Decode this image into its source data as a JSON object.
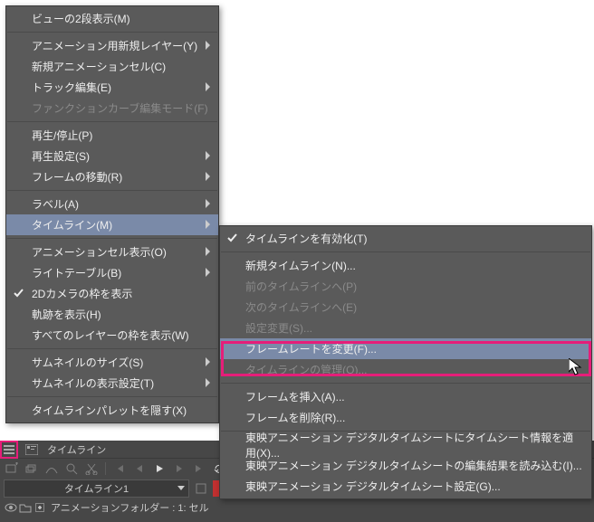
{
  "menu1": {
    "items": [
      {
        "label": "ビューの2段表示(M)",
        "arrow": false,
        "sep_after": true
      },
      {
        "label": "アニメーション用新規レイヤー(Y)",
        "arrow": true
      },
      {
        "label": "新規アニメーションセル(C)",
        "arrow": false
      },
      {
        "label": "トラック編集(E)",
        "arrow": true
      },
      {
        "label": "ファンクションカーブ編集モード(F)",
        "arrow": false,
        "disabled": true,
        "sep_after": true
      },
      {
        "label": "再生/停止(P)",
        "arrow": false
      },
      {
        "label": "再生設定(S)",
        "arrow": true
      },
      {
        "label": "フレームの移動(R)",
        "arrow": true,
        "sep_after": true
      },
      {
        "label": "ラベル(A)",
        "arrow": true
      },
      {
        "label": "タイムライン(M)",
        "arrow": true,
        "highlighted": true,
        "sep_after": true
      },
      {
        "label": "アニメーションセル表示(O)",
        "arrow": true
      },
      {
        "label": "ライトテーブル(B)",
        "arrow": true
      },
      {
        "label": "2Dカメラの枠を表示",
        "arrow": false,
        "checked": true
      },
      {
        "label": "軌跡を表示(H)",
        "arrow": false
      },
      {
        "label": "すべてのレイヤーの枠を表示(W)",
        "arrow": false,
        "sep_after": true
      },
      {
        "label": "サムネイルのサイズ(S)",
        "arrow": true
      },
      {
        "label": "サムネイルの表示設定(T)",
        "arrow": true,
        "sep_after": true
      },
      {
        "label": "タイムラインパレットを隠す(X)",
        "arrow": false
      }
    ]
  },
  "menu2": {
    "items": [
      {
        "label": "タイムラインを有効化(T)",
        "checked": true,
        "sep_after": true
      },
      {
        "label": "新規タイムライン(N)..."
      },
      {
        "label": "前のタイムラインへ(P)",
        "disabled": true
      },
      {
        "label": "次のタイムラインへ(E)",
        "disabled": true
      },
      {
        "label": "設定変更(S)...",
        "disabled": true
      },
      {
        "label": "フレームレートを変更(F)...",
        "highlighted": true
      },
      {
        "label": "タイムラインの管理(O)...",
        "disabled": true,
        "sep_after": true
      },
      {
        "label": "フレームを挿入(A)..."
      },
      {
        "label": "フレームを削除(R)...",
        "sep_after": true
      },
      {
        "label": "東映アニメーション  デジタルタイムシートにタイムシート情報を適用(X)..."
      },
      {
        "label": "東映アニメーション  デジタルタイムシートの編集結果を読み込む(I)..."
      },
      {
        "label": "東映アニメーション  デジタルタイムシート設定(G)..."
      }
    ]
  },
  "panel": {
    "tab_label": "タイムライン",
    "timeline_name": "タイムライン1",
    "folder_label": "アニメーションフォルダー : 1: セル"
  }
}
